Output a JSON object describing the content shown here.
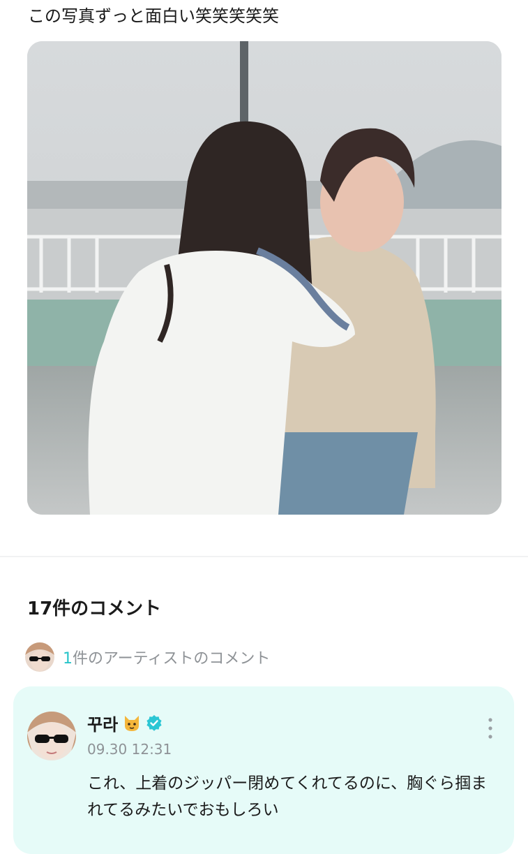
{
  "post": {
    "text": "この写真ずっと面白い笑笑笑笑笑",
    "photo_alt": "photo"
  },
  "comments": {
    "count_label": "17件のコメント",
    "artist_count": "1",
    "artist_suffix": "件のアーティストのコメント",
    "items": [
      {
        "author": "꾸라",
        "author_badge_icon": "cat-face-icon",
        "verified_icon": "verified-check-icon",
        "time": "09.30 12:31",
        "body": "これ、上着のジッパー閉めてくれてるのに、胸ぐら掴まれてるみたいでおもしろい",
        "more_icon": "more-vertical-icon"
      }
    ]
  },
  "colors": {
    "accent": "#27c4c9",
    "card_bg": "#e6fbf8",
    "muted_text": "#8e9296",
    "verified": "#2bc6d4"
  }
}
